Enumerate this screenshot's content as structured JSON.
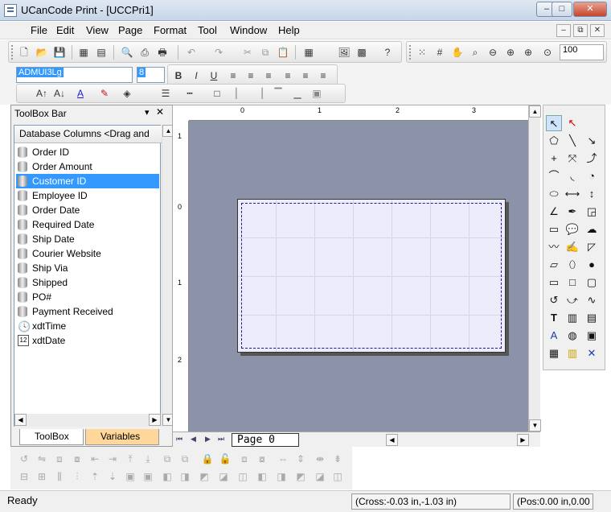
{
  "window": {
    "title": "UCanCode Print - [UCCPri1]",
    "min": "–",
    "max": "□",
    "close": "✕"
  },
  "menu": [
    "File",
    "Edit",
    "View",
    "Page",
    "Format",
    "Tool",
    "Window",
    "Help"
  ],
  "mdi": {
    "min": "–",
    "restore": "⧉",
    "close": "✕"
  },
  "toolbar": {
    "zoom": "100",
    "font_name": "ADMUI3Lg",
    "font_size": "8",
    "bold": "B",
    "italic": "I",
    "underline": "U"
  },
  "toolbox": {
    "title": "ToolBox Bar",
    "column_header": "Database Columns <Drag and",
    "items": [
      {
        "label": "Order ID",
        "icon": "db-icon"
      },
      {
        "label": "Order Amount",
        "icon": "db-icon"
      },
      {
        "label": "Customer ID",
        "icon": "db-icon",
        "selected": true
      },
      {
        "label": "Employee ID",
        "icon": "db-icon"
      },
      {
        "label": "Order Date",
        "icon": "db-icon"
      },
      {
        "label": "Required Date",
        "icon": "db-icon"
      },
      {
        "label": "Ship Date",
        "icon": "db-icon"
      },
      {
        "label": "Courier Website",
        "icon": "db-icon"
      },
      {
        "label": "Ship Via",
        "icon": "db-icon"
      },
      {
        "label": "Shipped",
        "icon": "db-icon"
      },
      {
        "label": "PO#",
        "icon": "db-icon"
      },
      {
        "label": "Payment Received",
        "icon": "db-icon"
      },
      {
        "label": "xdtTime",
        "icon": "clock-icon"
      },
      {
        "label": "xdtDate",
        "icon": "calendar-icon"
      }
    ],
    "tabs": [
      "ToolBox",
      "Variables"
    ]
  },
  "ruler": {
    "h": [
      "0",
      "1",
      "2",
      "3"
    ],
    "v": [
      "1",
      "0",
      "1",
      "2"
    ]
  },
  "page_tab": "Page   0",
  "status": {
    "ready": "Ready",
    "cross": "(Cross:-0.03 in,-1.03 in)",
    "pos": "(Pos:0.00 in,0.00"
  }
}
